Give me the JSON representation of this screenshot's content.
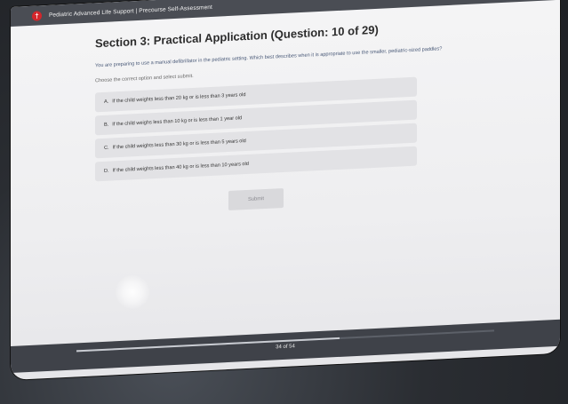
{
  "header": {
    "logo_glyph": "†",
    "title": "Pediatric Advanced Life Support | Precourse Self-Assessment"
  },
  "main": {
    "section_title": "Section 3: Practical Application (Question: 10 of 29)",
    "question": "You are preparing to use a manual defibrillator in the pediatric setting. Which best describes when it is appropriate to use the smaller, pediatric-sized paddles?",
    "instruction": "Choose the correct option and select submit.",
    "options": [
      {
        "letter": "A.",
        "text": "If the child weights less than 20 kg or is less than 3 years old"
      },
      {
        "letter": "B.",
        "text": "If the child weighs less than 10 kg or is less than 1 year old"
      },
      {
        "letter": "C.",
        "text": "If the child weights less than 30 kg or is less than 5 years old"
      },
      {
        "letter": "D.",
        "text": "If the child weights less than 40 kg or is less than 10 years old"
      }
    ],
    "submit_label": "Submit"
  },
  "footer": {
    "page_count": "34 of 54",
    "progress_fraction": 0.63
  },
  "colors": {
    "brand_red": "#d3262b",
    "topbar": "#4a4d54",
    "option_bg": "#e2e2e5",
    "question_text": "#4a5a78"
  }
}
